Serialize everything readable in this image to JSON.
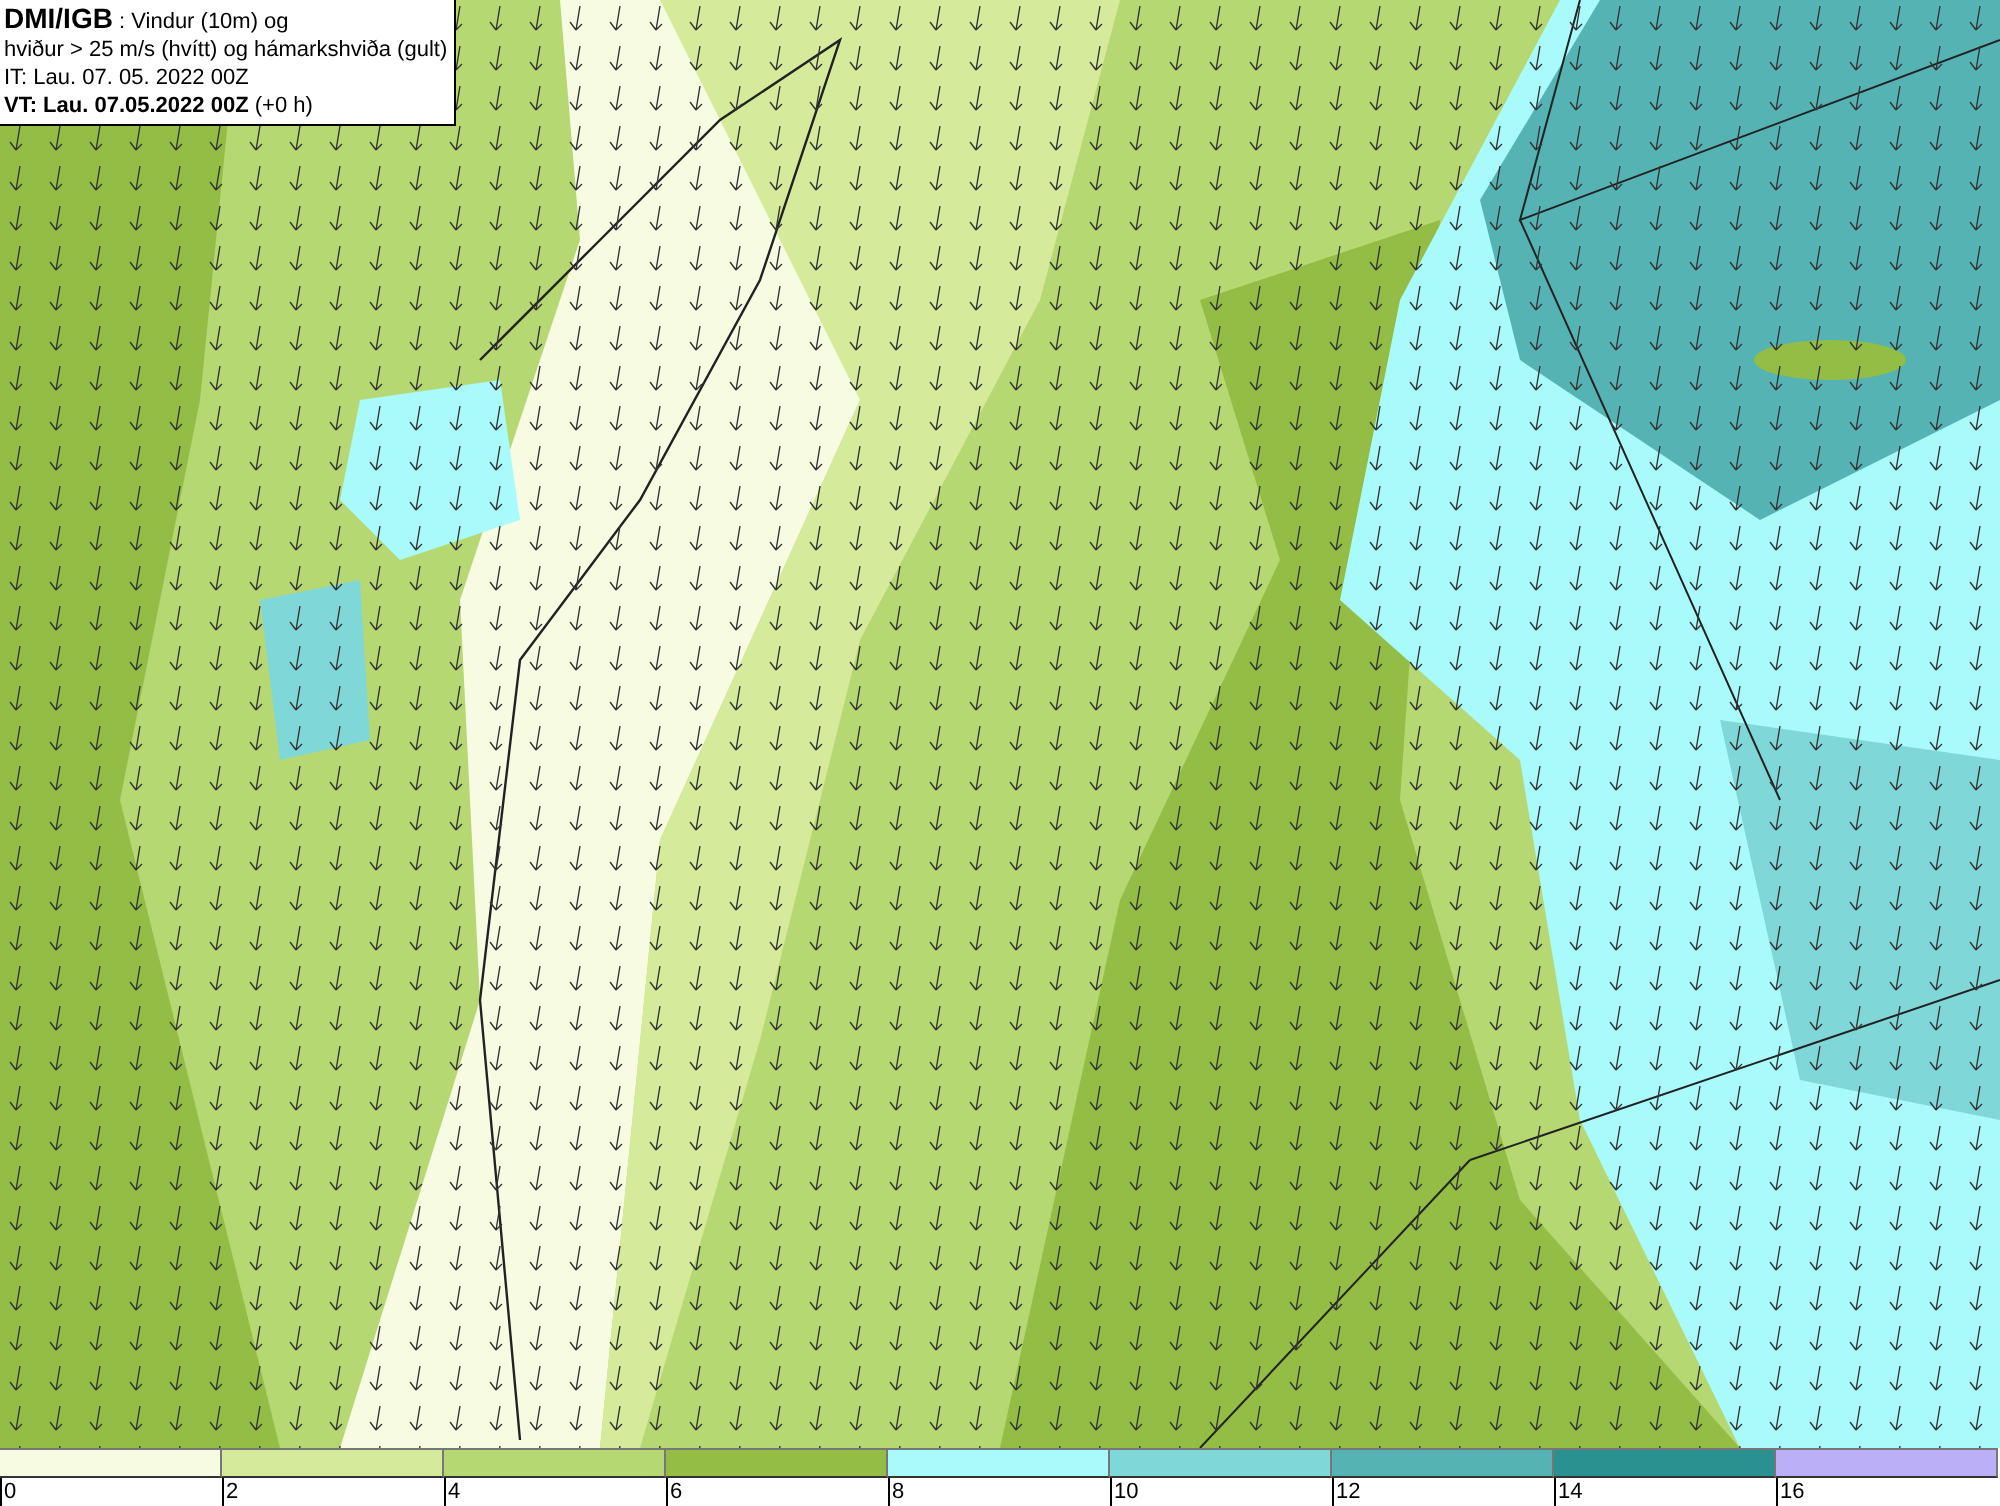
{
  "info_box": {
    "lines": [
      "**DMI/IGB** : Vindur (10m) og",
      "hviður > 25 m/s (hvítt) og hámarkshviða (gult)",
      "IT: Lau. 07. 05. 2022 00Z",
      "**VT: Lau. 07.05.2022 00Z** (+0 h)"
    ]
  },
  "legend": {
    "items": [
      {
        "label": "0",
        "color": "#f6fbe2"
      },
      {
        "label": "2",
        "color": "#d5eb9b"
      },
      {
        "label": "4",
        "color": "#b6d873"
      },
      {
        "label": "6",
        "color": "#93bd45"
      },
      {
        "label": "8",
        "color": "#a9fbfb"
      },
      {
        "label": "10",
        "color": "#80d7d7"
      },
      {
        "label": "12",
        "color": "#55b3b3"
      },
      {
        "label": "14",
        "color": "#2b9090"
      },
      {
        "label": "16",
        "color": "#bbb0f7"
      }
    ]
  }
}
